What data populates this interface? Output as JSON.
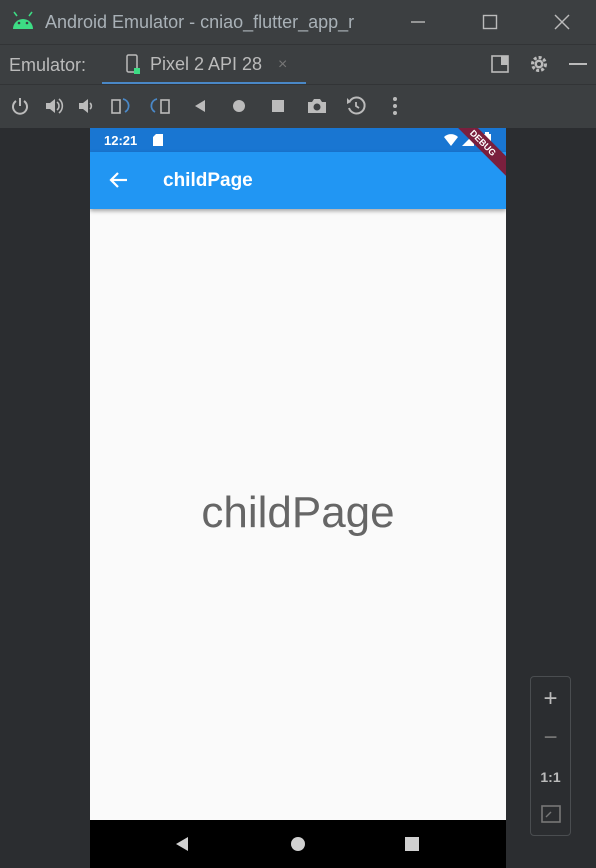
{
  "window": {
    "title": "Android Emulator - cniao_flutter_app_r",
    "minimize_glyph": "—",
    "maximize_glyph": "☐",
    "close_glyph": "✕"
  },
  "tabbar": {
    "label": "Emulator:",
    "tab_label": "Pixel 2 API 28",
    "tab_close": "×"
  },
  "toolbar": {
    "buttons": [
      "power-icon",
      "volume-up-icon",
      "volume-down-icon",
      "rotate-left-icon",
      "rotate-right-icon",
      "back-icon",
      "home-icon",
      "overview-icon",
      "screenshot-icon",
      "snapshot-icon",
      "more-icon"
    ]
  },
  "device": {
    "status_time": "12:21",
    "debug_banner": "DEBUG",
    "appbar_title": "childPage",
    "body_text": "childPage"
  },
  "zoom": {
    "plus": "+",
    "minus": "−",
    "one_to_one": "1:1"
  },
  "colors": {
    "appbar": "#2196f3",
    "statusbar": "#1976d2",
    "accent": "#4a88c7",
    "android_green": "#3ddc84"
  }
}
